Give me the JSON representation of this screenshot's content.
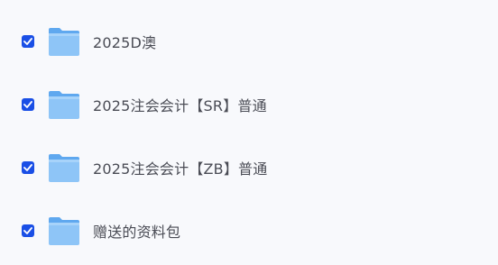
{
  "colors": {
    "checkbox_fill": "#1a4fe6",
    "folder_front": "#8ec5f7",
    "folder_back": "#5fa8ef",
    "text": "#4a4c55"
  },
  "items": [
    {
      "name": "2025D澳",
      "checked": true,
      "icon": "folder-icon"
    },
    {
      "name": "2025注会会计【SR】普通",
      "checked": true,
      "icon": "folder-icon"
    },
    {
      "name": "2025注会会计【ZB】普通",
      "checked": true,
      "icon": "folder-icon"
    },
    {
      "name": "赠送的资料包",
      "checked": true,
      "icon": "folder-icon"
    }
  ]
}
